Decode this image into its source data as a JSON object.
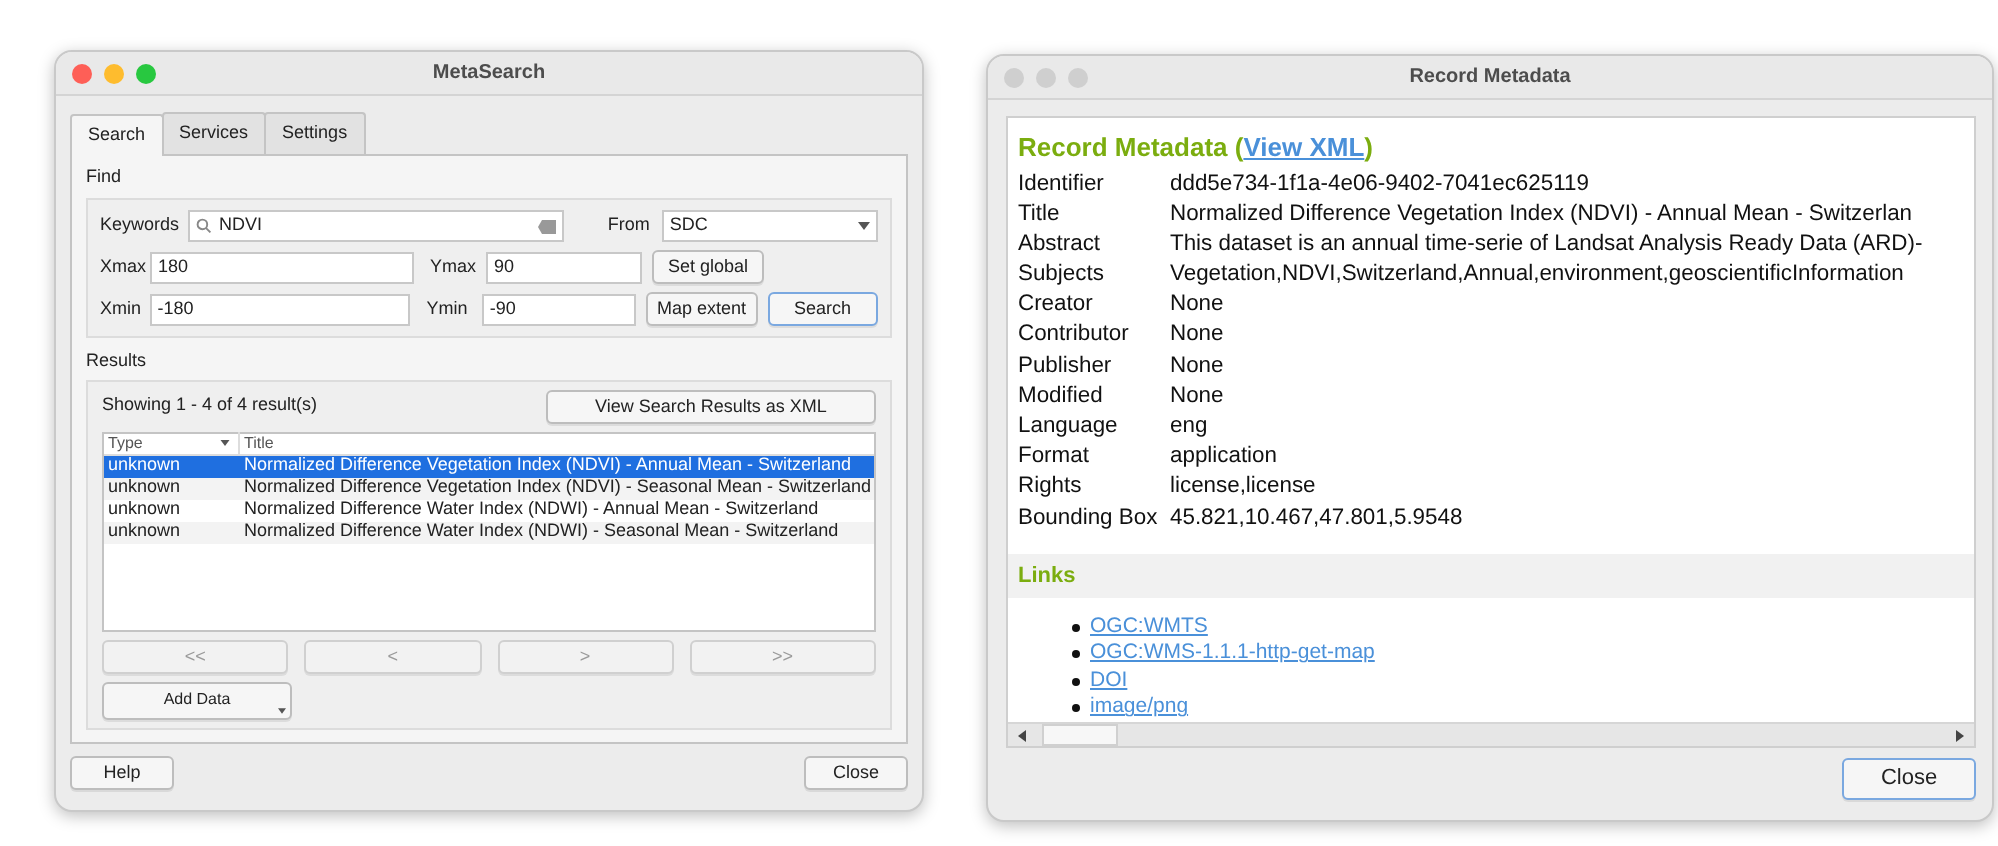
{
  "metasearch": {
    "title": "MetaSearch",
    "active": true,
    "tabs": [
      {
        "label": "Search",
        "selected": true
      },
      {
        "label": "Services",
        "selected": false
      },
      {
        "label": "Settings",
        "selected": false
      }
    ],
    "find": {
      "label": "Find",
      "keywords_label": "Keywords",
      "keywords_value": "NDVI",
      "from_label": "From",
      "from_value": "SDC",
      "rows": [
        {
          "fields": [
            {
              "label": "Xmax",
              "value": "180"
            },
            {
              "label": "Ymax",
              "value": "90"
            }
          ],
          "buttons": [
            {
              "label": "Set global",
              "default": false
            }
          ]
        },
        {
          "fields": [
            {
              "label": "Xmin",
              "value": "-180"
            },
            {
              "label": "Ymin",
              "value": "-90"
            }
          ],
          "buttons": [
            {
              "label": "Map extent",
              "default": false
            },
            {
              "label": "Search",
              "default": true
            }
          ]
        }
      ]
    },
    "results": {
      "label": "Results",
      "count": "Showing 1 - 4 of 4 result(s)",
      "xml_button": "View Search Results as XML",
      "columns": [
        "Type",
        "Title"
      ],
      "rows": [
        {
          "type": "unknown",
          "title": "Normalized Difference Vegetation Index (NDVI) - Annual Mean - Switzerland",
          "selected": true
        },
        {
          "type": "unknown",
          "title": "Normalized Difference Vegetation Index (NDVI) - Seasonal Mean - Switzerland",
          "selected": false
        },
        {
          "type": "unknown",
          "title": "Normalized Difference Water Index (NDWI) - Annual Mean - Switzerland",
          "selected": false
        },
        {
          "type": "unknown",
          "title": "Normalized Difference Water Index (NDWI) - Seasonal Mean - Switzerland",
          "selected": false
        }
      ],
      "paging": [
        {
          "label": "<<",
          "disabled": true
        },
        {
          "label": "<",
          "disabled": true
        },
        {
          "label": ">",
          "disabled": true
        },
        {
          "label": ">>",
          "disabled": true
        }
      ],
      "add_data": "Add Data"
    },
    "footer": [
      "Help",
      "Close"
    ]
  },
  "record": {
    "title": "Record Metadata",
    "active": false,
    "heading": "Record Metadata (",
    "heading_link": "View XML",
    "heading_end": ")",
    "fields": [
      {
        "label": "Identifier",
        "value": "ddd5e734-1f1a-4e06-9402-7041ec625119"
      },
      {
        "label": "Title",
        "value": "Normalized Difference Vegetation Index (NDVI) - Annual Mean - Switzerlan"
      },
      {
        "label": "Abstract",
        "value": "This dataset is an annual time-serie of Landsat Analysis Ready Data (ARD)-"
      },
      {
        "label": "Subjects",
        "value": "Vegetation,NDVI,Switzerland,Annual,environment,geoscientificInformation"
      },
      {
        "label": "Creator",
        "value": "None"
      },
      {
        "label": "Contributor",
        "value": "None"
      },
      {
        "label": "Publisher",
        "value": "None"
      },
      {
        "label": "Modified",
        "value": "None"
      },
      {
        "label": "Language",
        "value": "eng"
      },
      {
        "label": "Format",
        "value": "application"
      },
      {
        "label": "Rights",
        "value": "license,license"
      },
      {
        "label": "Bounding Box",
        "value": "45.821,10.467,47.801,5.9548"
      }
    ],
    "links_label": "Links",
    "links": [
      "OGC:WMTS",
      "OGC:WMS-1.1.1-http-get-map",
      "DOI",
      "image/png"
    ],
    "close": {
      "label": "Close",
      "default": true
    }
  }
}
